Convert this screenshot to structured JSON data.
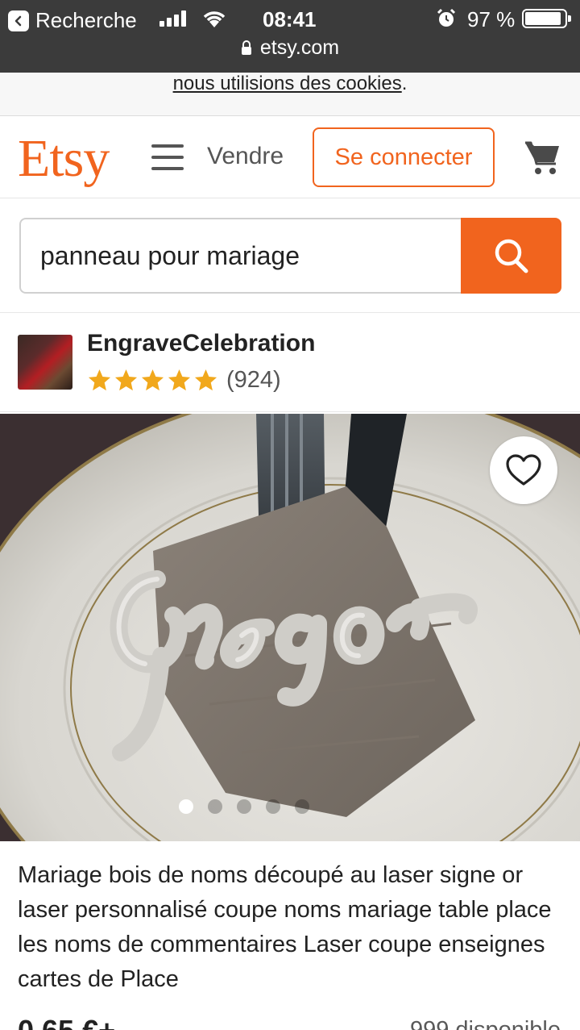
{
  "status_bar": {
    "back_label": "Recherche",
    "time": "08:41",
    "battery": "97 %",
    "url": "etsy.com"
  },
  "cookie_notice": {
    "link_text": "nous utilisions des cookies",
    "suffix": "."
  },
  "header": {
    "logo": "Etsy",
    "sell_label": "Vendre",
    "signin_label": "Se connecter"
  },
  "search": {
    "value": "panneau pour mariage"
  },
  "shop": {
    "name": "EngraveCelebration",
    "rating_stars": 5,
    "review_count": "(924)"
  },
  "listing": {
    "image_carousel": {
      "active_index": 0
    },
    "title": "Mariage bois de noms découpé au laser signe or laser personnalisé coupe noms mariage table place les noms de commentaires Laser coupe enseignes cartes de Place",
    "price": "0,65 €+",
    "stock": "999 disponible"
  },
  "colors": {
    "brand": "#f1641e",
    "star": "#f1a81c"
  }
}
